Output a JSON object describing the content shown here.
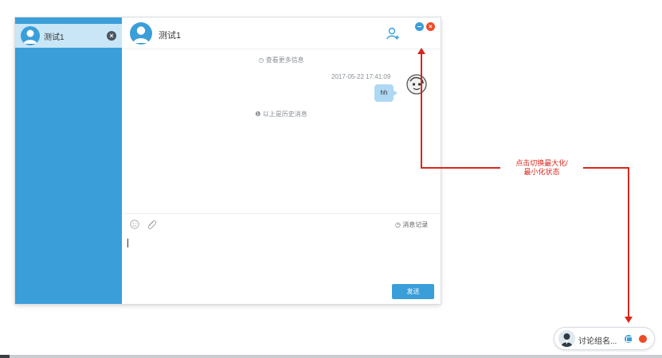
{
  "colors": {
    "sidebar": "#3a9ed9",
    "selected_item": "#c9e6f6",
    "bubble": "#aed8f3",
    "annotation": "#d9261c",
    "close": "#ee4b2b"
  },
  "sidebar": {
    "items": [
      {
        "name": "测试1",
        "icon": "user-avatar-icon",
        "close_icon": "close-circle-icon"
      }
    ]
  },
  "header": {
    "title": "测试1",
    "member_icon": "user-manage-icon",
    "minimize_icon": "minimize-icon",
    "close_icon": "close-icon"
  },
  "messages": {
    "more_link": "◷ 查看更多信息",
    "items": [
      {
        "time": "2017-05-22 17:41:09",
        "text": "hh"
      }
    ],
    "history_note": "❶ 以上是历史消息"
  },
  "toolbar": {
    "emoji_icon": "emoji-icon",
    "attach_icon": "paperclip-icon",
    "history_label": "◷ 消息记录"
  },
  "composer": {
    "value": ""
  },
  "send": {
    "label": "发送"
  },
  "annotation": {
    "line1": "点击切换最大化/",
    "line2": "最小化状态"
  },
  "minimized": {
    "name": "讨论组名...",
    "restore_icon": "restore-icon",
    "close_icon": "close-dot-icon"
  }
}
